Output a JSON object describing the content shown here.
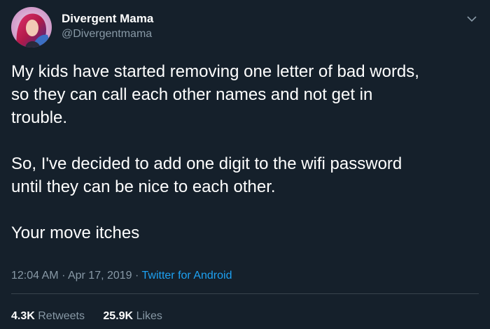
{
  "user": {
    "display_name": "Divergent Mama",
    "handle": "@Divergentmama"
  },
  "tweet": {
    "lines_para1": [
      "My kids have started removing one letter of bad words,",
      "so they can call each other names and not get in",
      "trouble."
    ],
    "lines_para2": [
      "So, I've decided to add one digit to the wifi password",
      "until they can be nice to each other."
    ],
    "lines_para3": [
      "Your move itches"
    ],
    "time": "12:04 AM",
    "separator": "·",
    "date": "Apr 17, 2019",
    "source": "Twitter for Android"
  },
  "stats": {
    "retweets_count": "4.3K",
    "retweets_label": "Retweets",
    "likes_count": "25.9K",
    "likes_label": "Likes"
  },
  "icons": {
    "avatar": "profile-photo",
    "caret": "chevron-down-icon"
  },
  "colors": {
    "background": "#15202b",
    "text_primary": "#ffffff",
    "text_secondary": "#8899a6",
    "link": "#1da1f2",
    "divider": "#38444d"
  }
}
